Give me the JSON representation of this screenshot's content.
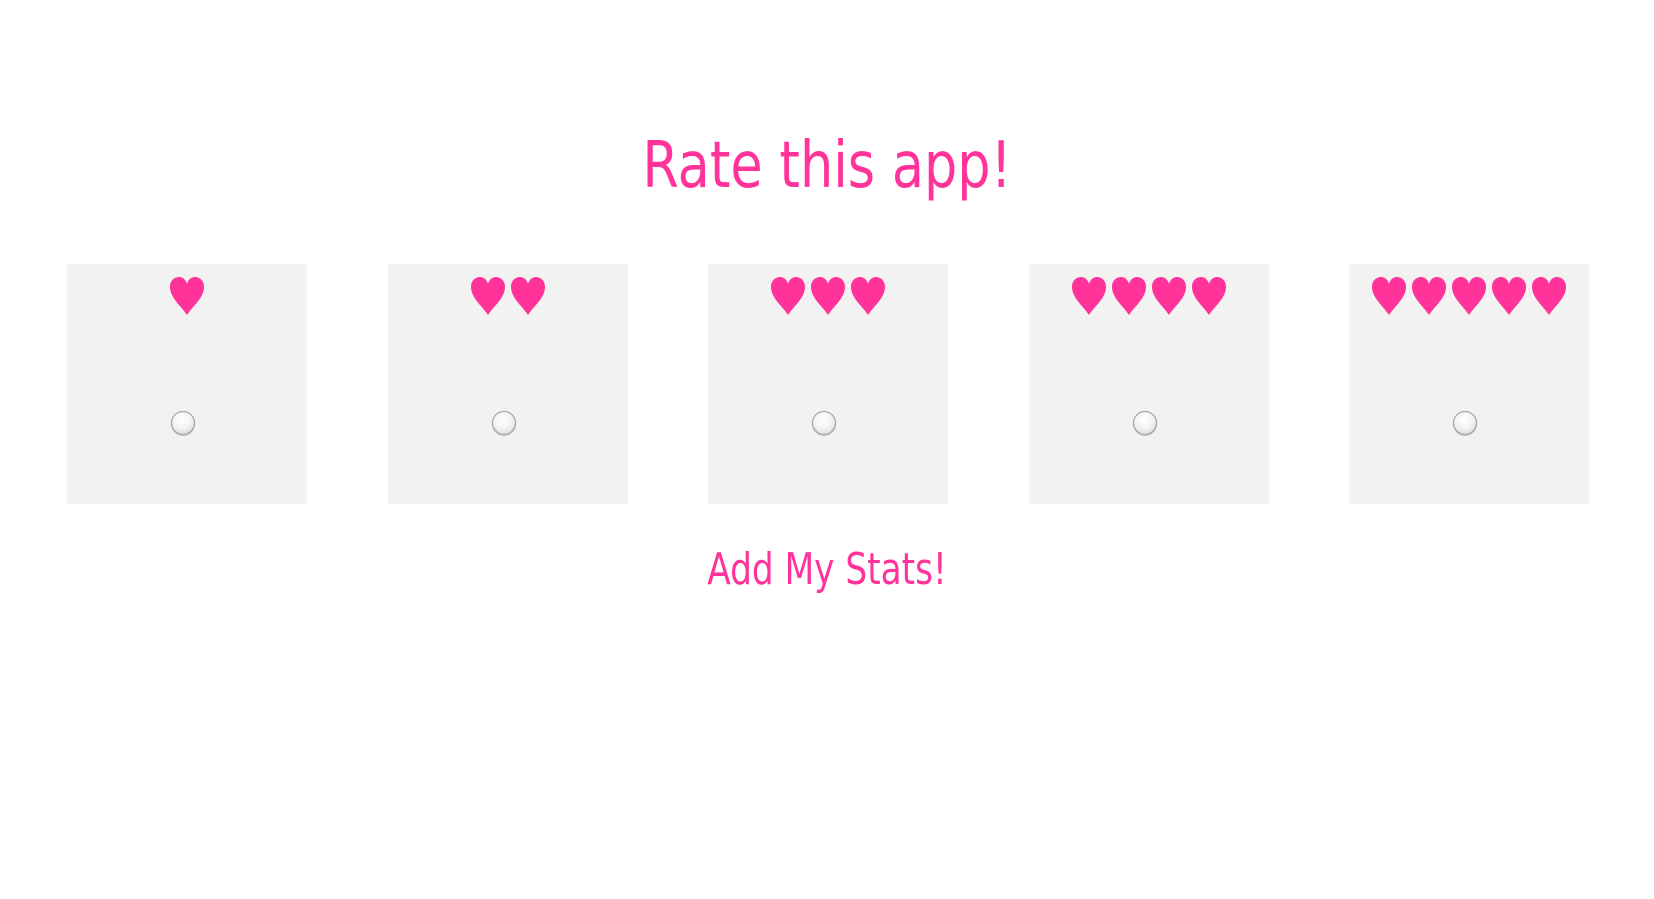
{
  "title": "Rate this app!",
  "accent_color": "#ff3399",
  "card_color": "#f2f2f2",
  "rating": {
    "options": [
      {
        "hearts": 1,
        "selected": false
      },
      {
        "hearts": 2,
        "selected": false
      },
      {
        "hearts": 3,
        "selected": false
      },
      {
        "hearts": 4,
        "selected": false
      },
      {
        "hearts": 5,
        "selected": false
      }
    ],
    "icon": "heart-icon"
  },
  "submit_label": "Add My Stats!"
}
